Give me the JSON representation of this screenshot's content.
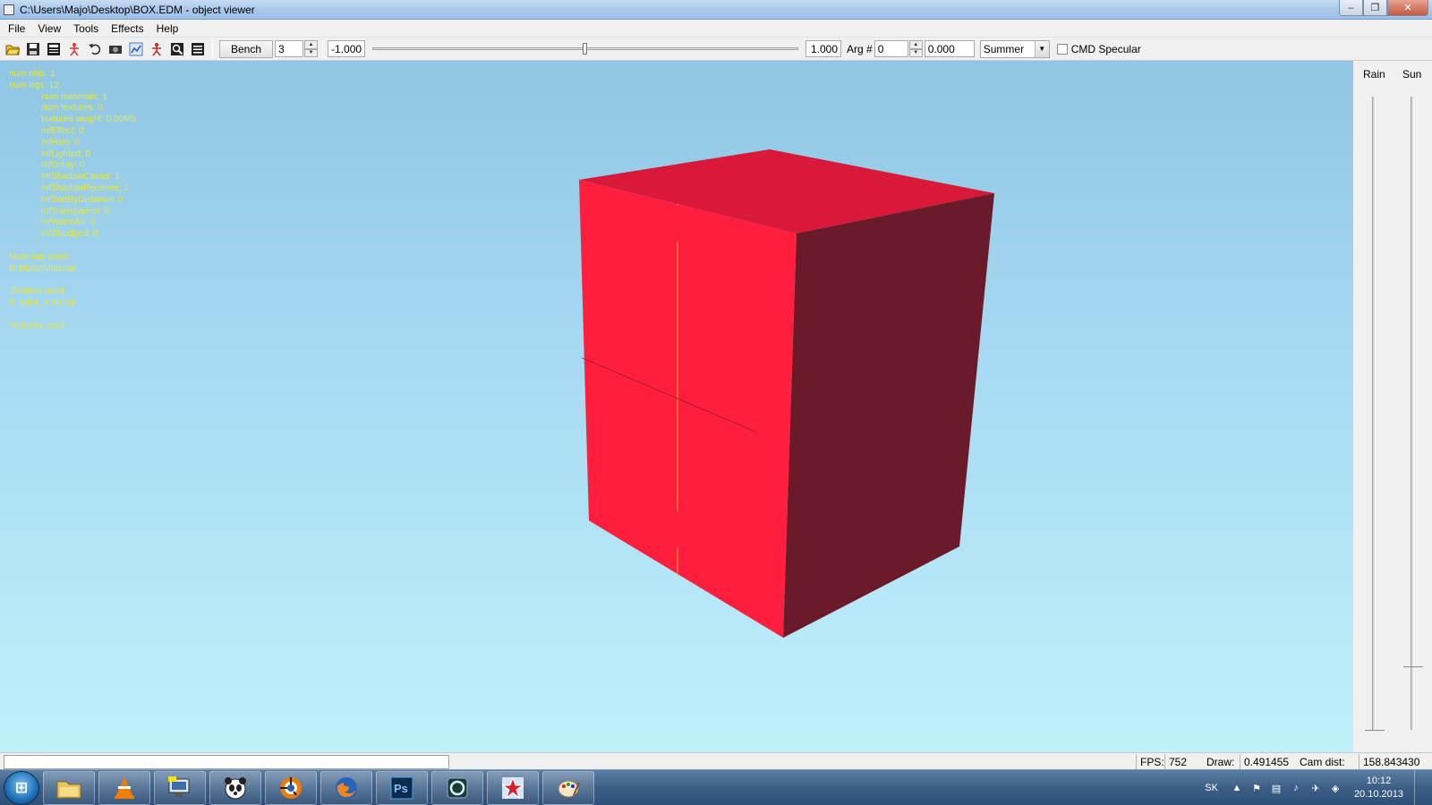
{
  "window": {
    "title": "C:\\Users\\Majo\\Desktop\\BOX.EDM - object viewer"
  },
  "menu": [
    "File",
    "View",
    "Tools",
    "Effects",
    "Help"
  ],
  "toolbar": {
    "icons": [
      "open-folder-icon",
      "save-icon",
      "save-as-icon",
      "figure-icon",
      "undo-icon",
      "camera-icon",
      "graph-icon",
      "figure-red-icon",
      "search-icon",
      "list-icon"
    ],
    "bench_label": "Bench",
    "bench_value": "3",
    "range_min": "-1.000",
    "range_max": "1.000",
    "slider_position": 0.5,
    "arg_label": "Arg #",
    "arg_value": "0",
    "arg_float": "0.000",
    "season": "Summer",
    "specular_label": "CMD Specular",
    "specular_checked": false
  },
  "stats": {
    "top": [
      "num objs: 1",
      "num trgs: 12"
    ],
    "indented": [
      "num materials: 1",
      "num textures: 0",
      "textures weight: 0.00Mb",
      "mfEffect: 0",
      "mfHalo: 0",
      "mfLighted: 0",
      "mfOnlay: 0",
      "mfShadowCaster: 1",
      "mfShadowReceiver: 1",
      "mfSortByDistance: 0",
      "mfTransparent: 0",
      "mfWarmAir: 0",
      "mfZNudged: 0"
    ],
    "materials_header": "Materials used:",
    "materials": [
      "0: ModelMaterial"
    ],
    "shaders_header": "Shaders used:",
    "shaders": [
      "0: color_material"
    ],
    "textures_header": "Textures used:"
  },
  "colors": {
    "stats_text": "#e8e83a",
    "cube_front": "#ff1e3e",
    "cube_top": "#d8193a",
    "cube_side": "#6a1a28"
  },
  "side_panel": {
    "rain_label": "Rain",
    "sun_label": "Sun",
    "rain_level": 0.0,
    "sun_level": 0.1
  },
  "status": {
    "fps_label": "FPS:",
    "fps_value": "752",
    "draw_label": "Draw:",
    "draw_value": "0.491455",
    "cam_label": "Cam dist:",
    "cam_value": "158.843430"
  },
  "taskbar": {
    "apps": [
      "explorer-icon",
      "vlc-icon",
      "computer-icon",
      "panda-icon",
      "blender-icon",
      "firefox-icon",
      "photoshop-icon",
      "app-s-icon",
      "star-icon",
      "paint-icon"
    ],
    "tray": {
      "lang": "SK",
      "time": "10:12",
      "date": "20.10.2013"
    }
  }
}
